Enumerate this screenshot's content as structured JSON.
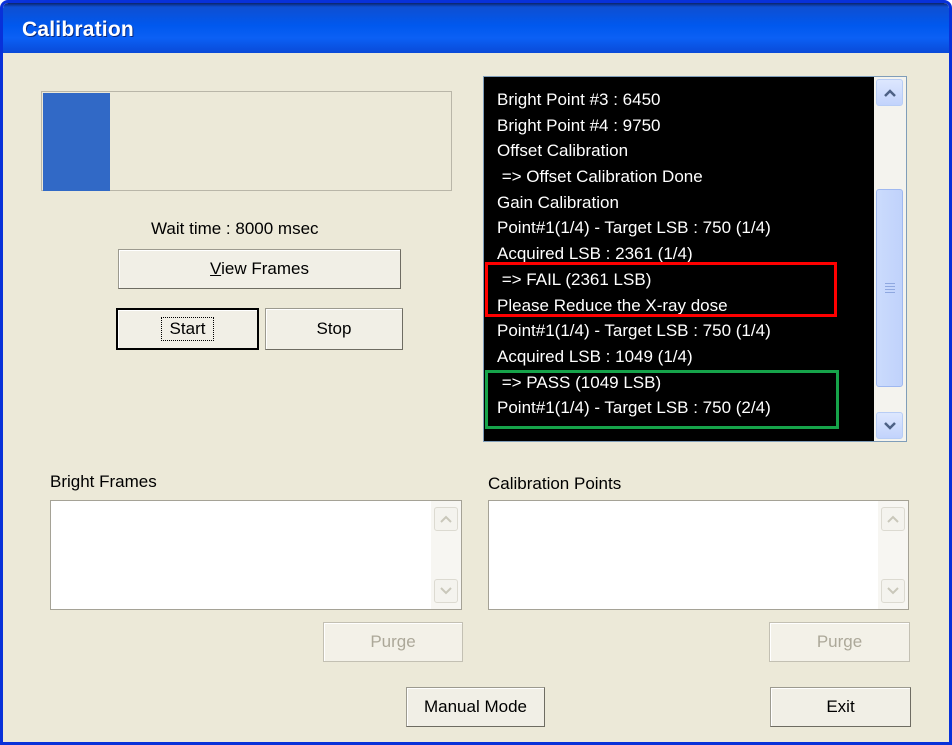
{
  "window": {
    "title": "Calibration"
  },
  "progress": {
    "fraction": 0.165
  },
  "status": {
    "wait_text": "Wait time : 8000 msec"
  },
  "buttons": {
    "view_frames_accel": "V",
    "view_frames_rest": "iew Frames",
    "start": "Start",
    "stop": "Stop",
    "purge_left": "Purge",
    "purge_right": "Purge",
    "manual_mode": "Manual Mode",
    "exit": "Exit"
  },
  "log": {
    "lines": [
      "Bright Point #3 : 6450",
      "Bright Point #4 : 9750",
      "Offset Calibration",
      " => Offset Calibration Done",
      "Gain Calibration",
      "Point#1(1/4) - Target LSB : 750 (1/4)",
      "Acquired LSB : 2361 (1/4)",
      " => FAIL (2361 LSB)",
      "Please Reduce the X-ray dose",
      "Point#1(1/4) - Target LSB : 750 (1/4)",
      "Acquired LSB : 1049 (1/4)",
      " => PASS (1049 LSB)",
      "Point#1(1/4) - Target LSB : 750 (2/4)"
    ]
  },
  "lists": {
    "bright_frames_label": "Bright Frames",
    "calibration_points_label": "Calibration Points"
  },
  "colors": {
    "titlebar": "#0058ee",
    "progress_fill": "#3169c6",
    "fail_highlight": "#ff0000",
    "pass_highlight": "#16a34a",
    "log_background": "#000000",
    "log_text": "#ffffff"
  },
  "icons": {
    "scroll_up": "chevron-up-icon",
    "scroll_down": "chevron-down-icon"
  }
}
